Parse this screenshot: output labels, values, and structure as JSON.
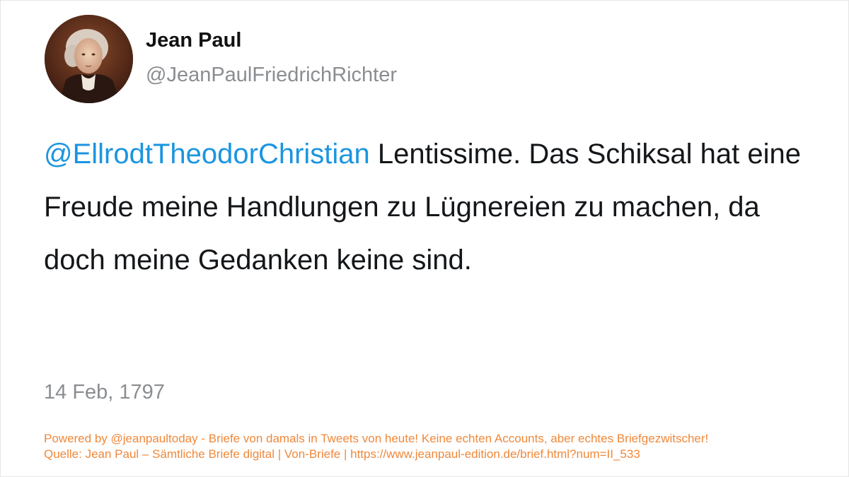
{
  "tweet": {
    "author": {
      "display_name": "Jean Paul",
      "handle": "@JeanPaulFriedrichRichter"
    },
    "mention": "@EllrodtTheodorChristian",
    "text": " Lentissime. Das Schiksal hat eine Freude meine Handlungen zu Lügnereien zu machen, da doch meine Gedanken keine sind.",
    "date": "14 Feb, 1797"
  },
  "footer": {
    "line1": "Powered by @jeanpaultoday - Briefe von damals in Tweets von heute! Keine echten Accounts, aber echtes Briefgezwitscher!",
    "line2": "Quelle: Jean Paul – Sämtliche Briefe digital | Von-Briefe | https://www.jeanpaul-edition.de/brief.html?num=II_533"
  },
  "colors": {
    "mention": "#1b95e0",
    "footer": "#f0883a",
    "muted": "#8a8d91",
    "text": "#14171a"
  }
}
